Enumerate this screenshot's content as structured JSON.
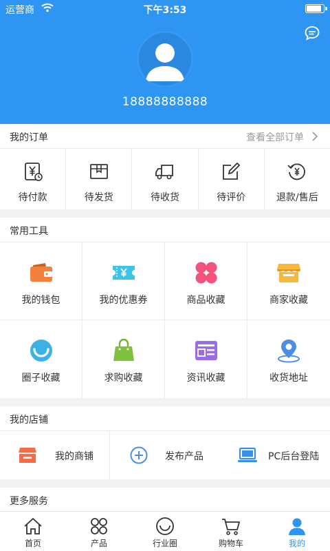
{
  "status_bar": {
    "carrier": "运营商",
    "time": "下午3:53"
  },
  "profile": {
    "phone": "18888888888"
  },
  "orders": {
    "title": "我的订单",
    "view_all": "查看全部订单",
    "items": [
      {
        "label": "待付款",
        "icon": "wallet-yen-icon"
      },
      {
        "label": "待发货",
        "icon": "package-icon"
      },
      {
        "label": "待收货",
        "icon": "truck-icon"
      },
      {
        "label": "待评价",
        "icon": "edit-icon"
      },
      {
        "label": "退款/售后",
        "icon": "refund-icon"
      }
    ]
  },
  "tools": {
    "title": "常用工具",
    "items": [
      {
        "label": "我的钱包",
        "icon": "wallet-icon"
      },
      {
        "label": "我的优惠券",
        "icon": "coupon-icon"
      },
      {
        "label": "商品收藏",
        "icon": "clover-icon"
      },
      {
        "label": "商家收藏",
        "icon": "store-icon"
      },
      {
        "label": "圈子收藏",
        "icon": "smile-icon"
      },
      {
        "label": "求购收藏",
        "icon": "shopping-bag-icon"
      },
      {
        "label": "资讯收藏",
        "icon": "news-icon"
      },
      {
        "label": "收货地址",
        "icon": "location-pin-icon"
      }
    ]
  },
  "shop": {
    "title": "我的店铺",
    "items": [
      {
        "label": "我的商铺",
        "icon": "shop-icon"
      },
      {
        "label": "发布产品",
        "icon": "plus-circle-icon"
      },
      {
        "label": "PC后台登陆",
        "icon": "laptop-icon"
      }
    ]
  },
  "more": {
    "title": "更多服务"
  },
  "tabbar": {
    "items": [
      {
        "label": "首页",
        "icon": "home-icon"
      },
      {
        "label": "产品",
        "icon": "grid-icon"
      },
      {
        "label": "行业圈",
        "icon": "circle-icon"
      },
      {
        "label": "购物车",
        "icon": "cart-icon"
      },
      {
        "label": "我的",
        "icon": "user-icon",
        "active": true
      }
    ]
  },
  "colors": {
    "brand": "#2f95f3",
    "orange": "#f5803e",
    "cyan": "#3cc4e8",
    "pink": "#f2527c",
    "yellow": "#f9b83c",
    "green": "#7ec13c",
    "purple": "#9b6ce8",
    "blue": "#4b8fe2"
  }
}
